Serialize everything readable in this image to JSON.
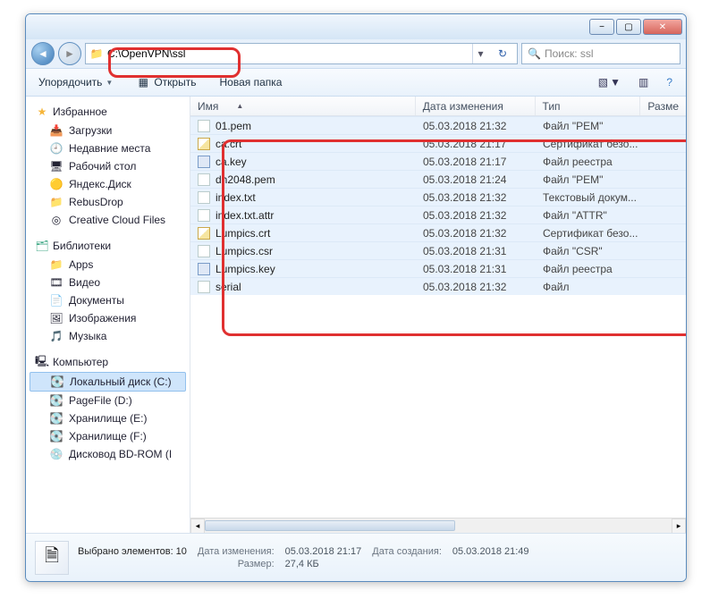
{
  "window": {
    "min": "−",
    "max": "▢",
    "close": "✕"
  },
  "addressbar": {
    "path": "C:\\OpenVPN\\ssl",
    "refresh_glyph": "↻",
    "dropdown_glyph": "▾"
  },
  "search": {
    "placeholder": "Поиск: ssl",
    "icon": "🔍"
  },
  "toolbar": {
    "organize": "Упорядочить",
    "open": "Открыть",
    "newfolder": "Новая папка",
    "view_glyph": "▧",
    "preview_glyph": "▥",
    "help_glyph": "?"
  },
  "sidebar": {
    "favorites": {
      "label": "Избранное",
      "items": [
        {
          "icon": "📥",
          "label": "Загрузки"
        },
        {
          "icon": "🕘",
          "label": "Недавние места"
        },
        {
          "icon": "🖥",
          "label": "Рабочий стол"
        },
        {
          "icon": "🟡",
          "label": "Яндекс.Диск"
        },
        {
          "icon": "📁",
          "label": "RebusDrop"
        },
        {
          "icon": "◎",
          "label": "Creative Cloud Files"
        }
      ]
    },
    "libraries": {
      "label": "Библиотеки",
      "items": [
        {
          "icon": "📁",
          "label": "Apps"
        },
        {
          "icon": "🎞",
          "label": "Видео"
        },
        {
          "icon": "📄",
          "label": "Документы"
        },
        {
          "icon": "🖼",
          "label": "Изображения"
        },
        {
          "icon": "🎵",
          "label": "Музыка"
        }
      ]
    },
    "computer": {
      "label": "Компьютер",
      "items": [
        {
          "icon": "💽",
          "label": "Локальный диск (C:)",
          "selected": true
        },
        {
          "icon": "💽",
          "label": "PageFile (D:)"
        },
        {
          "icon": "💽",
          "label": "Хранилище (E:)"
        },
        {
          "icon": "💽",
          "label": "Хранилище (F:)"
        },
        {
          "icon": "💿",
          "label": "Дисковод BD-ROM (I"
        }
      ]
    }
  },
  "columns": {
    "name": "Имя",
    "date": "Дата изменения",
    "type": "Тип",
    "size": "Разме"
  },
  "files": [
    {
      "name": "01.pem",
      "date": "05.03.2018 21:32",
      "type": "Файл \"PEM\"",
      "iconcls": ""
    },
    {
      "name": "ca.crt",
      "date": "05.03.2018 21:17",
      "type": "Сертификат безо...",
      "iconcls": "cert"
    },
    {
      "name": "ca.key",
      "date": "05.03.2018 21:17",
      "type": "Файл реестра",
      "iconcls": "key"
    },
    {
      "name": "dh2048.pem",
      "date": "05.03.2018 21:24",
      "type": "Файл \"PEM\"",
      "iconcls": ""
    },
    {
      "name": "index.txt",
      "date": "05.03.2018 21:32",
      "type": "Текстовый докум...",
      "iconcls": ""
    },
    {
      "name": "index.txt.attr",
      "date": "05.03.2018 21:32",
      "type": "Файл \"ATTR\"",
      "iconcls": ""
    },
    {
      "name": "Lumpics.crt",
      "date": "05.03.2018 21:32",
      "type": "Сертификат безо...",
      "iconcls": "cert"
    },
    {
      "name": "Lumpics.csr",
      "date": "05.03.2018 21:31",
      "type": "Файл \"CSR\"",
      "iconcls": ""
    },
    {
      "name": "Lumpics.key",
      "date": "05.03.2018 21:31",
      "type": "Файл реестра",
      "iconcls": "key"
    },
    {
      "name": "serial",
      "date": "05.03.2018 21:32",
      "type": "Файл",
      "iconcls": ""
    }
  ],
  "details": {
    "title": "Выбрано элементов: 10",
    "date_mod_label": "Дата изменения:",
    "date_mod": "05.03.2018 21:17",
    "date_cre_label": "Дата создания:",
    "date_cre": "05.03.2018 21:49",
    "size_label": "Размер:",
    "size": "27,4 КБ"
  }
}
